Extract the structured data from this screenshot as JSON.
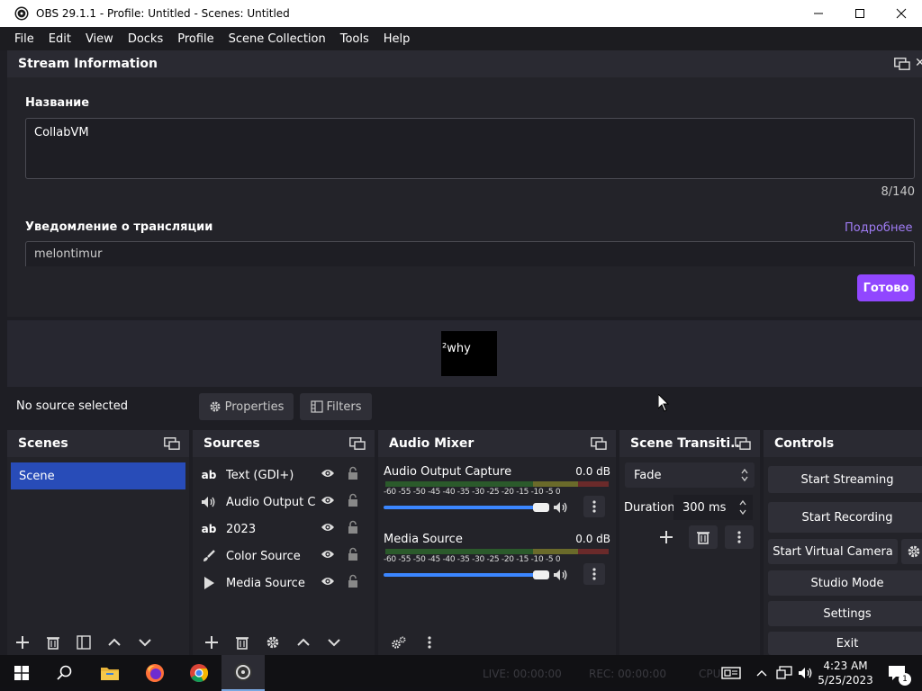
{
  "window": {
    "title": "OBS 29.1.1 - Profile: Untitled - Scenes: Untitled"
  },
  "menu": [
    "File",
    "Edit",
    "View",
    "Docks",
    "Profile",
    "Scene Collection",
    "Tools",
    "Help"
  ],
  "stream_info": {
    "title": "Stream Information",
    "name_label": "Название",
    "name_value": "CollabVM",
    "counter": "8/140",
    "notification_label": "Уведомление о трансляции",
    "more_link": "Подробнее",
    "notification_value": "melontimur",
    "done_button": "Готово"
  },
  "preview": {
    "text": "²why"
  },
  "source_bar": {
    "no_source": "No source selected",
    "properties": "Properties",
    "filters": "Filters"
  },
  "scenes": {
    "title": "Scenes",
    "items": [
      "Scene"
    ]
  },
  "sources": {
    "title": "Sources",
    "items": [
      "Text (GDI+)",
      "Audio Output Capture",
      "2023",
      "Color Source",
      "Media Source"
    ]
  },
  "mixer": {
    "title": "Audio Mixer",
    "ticks": "-60 -55 -50 -45 -40 -35 -30 -25 -20 -15 -10 -5  0",
    "channels": [
      {
        "name": "Audio Output Capture",
        "db": "0.0 dB",
        "volume": 1.0
      },
      {
        "name": "Media Source",
        "db": "0.0 dB",
        "volume": 1.0
      }
    ]
  },
  "transitions": {
    "title": "Scene Transiti...",
    "selected": "Fade",
    "duration_label": "Duration",
    "duration_value": "300 ms"
  },
  "controls": {
    "title": "Controls",
    "start_streaming": "Start Streaming",
    "start_recording": "Start Recording",
    "start_virtual_camera": "Start Virtual Camera",
    "studio_mode": "Studio Mode",
    "settings": "Settings",
    "exit": "Exit"
  },
  "status": {
    "live": "LIVE: 00:00:00",
    "rec": "REC: 00:00:00",
    "cpu": "CPU"
  },
  "taskbar": {
    "time": "4:23 AM",
    "date": "5/25/2023",
    "notification_count": "1"
  },
  "colors": {
    "accent": "#9147ff",
    "scene_selected": "#284cb8",
    "slider": "#3b86ff"
  }
}
